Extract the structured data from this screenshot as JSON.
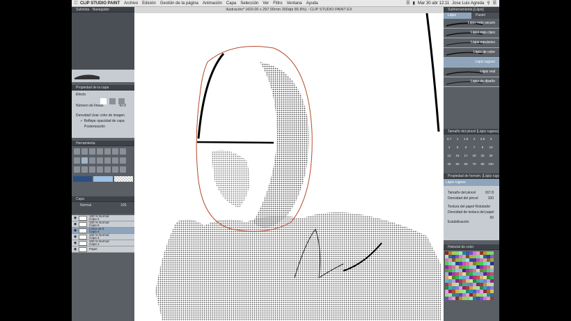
{
  "menubar": {
    "app": "CLIP STUDIO PAINT",
    "items": [
      "Archivo",
      "Edición",
      "Gestión de la página",
      "Animación",
      "Capa",
      "Selección",
      "Ver",
      "Filtro",
      "Ventana",
      "Ayuda"
    ],
    "datetime": "Mar 30 abr 12:11",
    "user": "Jose Luis Agreda"
  },
  "window": {
    "title": "ilustración* (420.00 x 297.00mm 300dpi 85.8%) - CLIP STUDIO PAINT EX"
  },
  "left": {
    "subview_title": "Subvista",
    "navigator_title": "Navegador",
    "layer_property_title": "Propiedad de la capa",
    "effect_label": "Efecto",
    "tone_label": "Número de líneas",
    "density_label": "Densidad",
    "density_value": "42.0",
    "use_color_label": "Usar color de imagen",
    "reflect_opacity_label": "Reflejar opacidad de capa",
    "posterization_label": "Posterización",
    "tool_title": "Herramienta",
    "layer_title": "Capa",
    "blend_mode": "Normal",
    "opacity": "100",
    "layers": [
      {
        "line1": "100 % Normal",
        "line2": "Capa 2",
        "selected": false
      },
      {
        "line1": "100 % Normal",
        "line2": "Capa 5",
        "selected": false
      },
      {
        "line1": "Línea 42.0",
        "line2": "Capa 4",
        "selected": true
      },
      {
        "line1": "100 % Normal",
        "line2": "Capa 3",
        "selected": false
      },
      {
        "line1": "100 % Normal",
        "line2": "Capa 1",
        "selected": false
      },
      {
        "line1": "Papel",
        "line2": "",
        "selected": false
      }
    ]
  },
  "right": {
    "sub_tool_title": "Subherramienta [Lápiz]",
    "tabs": [
      "Lápiz",
      "Pastel"
    ],
    "brushes": [
      {
        "name": "Lápiz más oscuro",
        "selected": false
      },
      {
        "name": "Lápiz más claro",
        "selected": false
      },
      {
        "name": "Lápiz mecánico",
        "selected": false
      },
      {
        "name": "Lápiz de color",
        "selected": false
      },
      {
        "name": "Lápiz rugoso",
        "selected": true
      },
      {
        "name": "Lápiz real",
        "selected": false
      },
      {
        "name": "Lápiz de diseño",
        "selected": false
      }
    ],
    "brush_size_title": "Tamaño del pincel [Lápiz rugoso]",
    "sizes": [
      "0.7",
      "1",
      "1.5",
      "2",
      "2.5",
      "3",
      "4",
      "5",
      "6",
      "7",
      "8",
      "10",
      "12",
      "15",
      "17",
      "20",
      "25",
      "30",
      "40",
      "50",
      "60",
      "70",
      "80",
      "100"
    ],
    "tool_property_title": "Propiedad de herram. [Lápiz rugoso]",
    "tool_name": "Lápiz rugoso",
    "brush_size_label": "Tamaño del pincel",
    "brush_size_value": "167.8",
    "brush_density_label": "Densidad del pincel",
    "brush_density_value": "100",
    "paper_texture_label": "Textura del papel",
    "paper_texture_value": "Rotulador",
    "texture_density_label": "Densidad de textura del papel",
    "texture_density_value": "60",
    "stabilization_label": "Estabilización",
    "color_history_title": "Historial de color"
  },
  "colors": {
    "panel": "#5a5f66",
    "panel_dark": "#3d4248",
    "panel_light": "#c7ccd2",
    "selection": "#8da4bb"
  }
}
